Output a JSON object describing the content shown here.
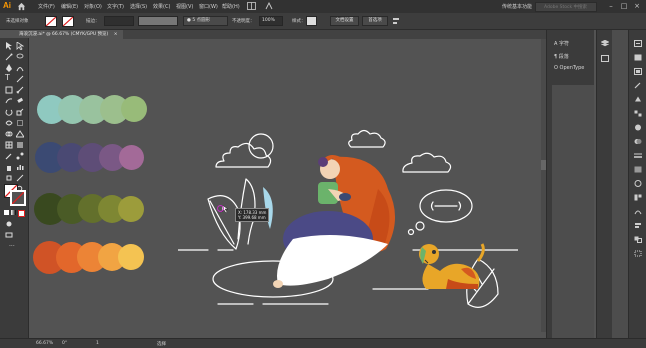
{
  "app": {
    "logo": "Ai"
  },
  "menu": [
    "文件(F)",
    "编辑(E)",
    "对象(O)",
    "文字(T)",
    "选择(S)",
    "效果(C)",
    "视图(V)",
    "窗口(W)",
    "帮助(H)"
  ],
  "workspace": "传统基本功能",
  "search": {
    "placeholder": "Adobe Stock 中搜索"
  },
  "controlbar": {
    "selection_label": "未选择对象",
    "stroke_label": "描边：",
    "brush_label": "5 点圆形",
    "opacity_label": "不透明度：",
    "opacity_value": "100%",
    "style_label": "样式：",
    "doc_setup": "文档设置",
    "prefs": "首选项"
  },
  "tab": {
    "title": "海浪沉浸.ai* @ 66.67% (CMYK/GPU 预览)",
    "close": "×"
  },
  "panels": {
    "items": [
      "字符",
      "段落",
      "OpenType"
    ]
  },
  "statusbar": {
    "zoom": "66.67%",
    "angle": "0°",
    "page": "1",
    "tool": "选择"
  },
  "tooltip": {
    "line1": "X: 178.33 mm",
    "line2": "Y: 399.68 mm"
  },
  "colors": {
    "row1": [
      "#8fc9c0",
      "#95c6b0",
      "#99c29e",
      "#9cbf8d",
      "#98bb79"
    ],
    "row2": [
      "#3b4a73",
      "#4a4973",
      "#5e4d77",
      "#7a5885",
      "#a36a98"
    ],
    "row3": [
      "#39491f",
      "#4a5b26",
      "#63702c",
      "#7e8733",
      "#9c9c3b"
    ],
    "row4": [
      "#d05326",
      "#e2672b",
      "#ec8436",
      "#f1a443",
      "#f4c352"
    ]
  }
}
